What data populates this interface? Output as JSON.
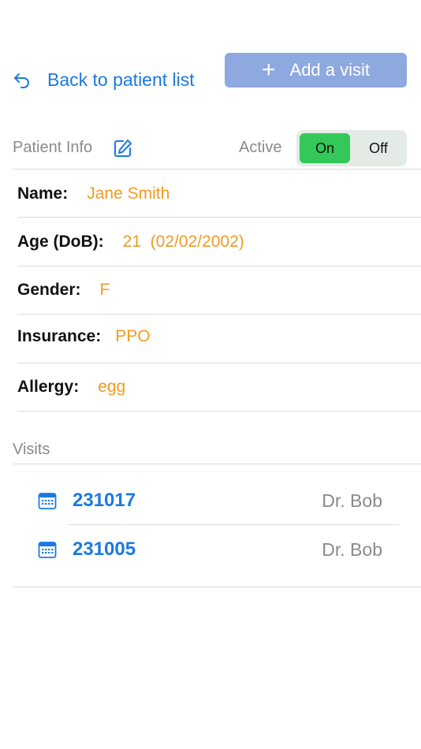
{
  "header": {
    "back_label": "Back to patient list",
    "add_visit_label": "Add a visit"
  },
  "patient_info": {
    "section_label": "Patient Info",
    "active_label": "Active",
    "toggle_on": "On",
    "toggle_off": "Off",
    "toggle_selected": "On",
    "fields": [
      {
        "label": "Name:",
        "value": "Jane Smith"
      },
      {
        "label": "Age (DoB):",
        "value": "21  (02/02/2002)"
      },
      {
        "label": "Gender:",
        "value": "F"
      },
      {
        "label": "Insurance:",
        "value": "PPO"
      },
      {
        "label": "Allergy:",
        "value": "egg"
      }
    ]
  },
  "visits": {
    "section_label": "Visits",
    "items": [
      {
        "id": "231017",
        "doctor": "Dr. Bob"
      },
      {
        "id": "231005",
        "doctor": "Dr. Bob"
      }
    ]
  },
  "colors": {
    "link_blue": "#1a7ae0",
    "button_blue": "#8ea8e0",
    "value_orange": "#f29a22",
    "toggle_green": "#34c759",
    "muted_gray": "#8a8a8e"
  },
  "icons": {
    "back": "back-arrow-icon",
    "add": "plus-icon",
    "edit": "edit-icon",
    "visit": "calendar-icon"
  }
}
